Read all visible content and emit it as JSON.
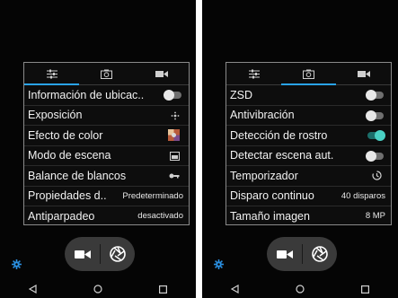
{
  "screens": [
    {
      "tabs": [
        {
          "icon": "sliders-icon"
        },
        {
          "icon": "camera-icon"
        },
        {
          "icon": "video-icon"
        }
      ],
      "active_tab": 0,
      "settings": [
        {
          "label": "Información de ubicac..",
          "control": "toggle",
          "state": "off"
        },
        {
          "label": "Exposición",
          "control": "icon",
          "icon": "exposure-icon"
        },
        {
          "label": "Efecto de color",
          "control": "icon",
          "icon": "color-effect-icon"
        },
        {
          "label": "Modo de escena",
          "control": "icon",
          "icon": "scene-mode-icon"
        },
        {
          "label": "Balance de blancos",
          "control": "icon",
          "icon": "white-balance-icon"
        },
        {
          "label": "Propiedades d..",
          "control": "value",
          "value": "Predeterminado"
        },
        {
          "label": "Antiparpadeo",
          "control": "value",
          "value": "desactivado"
        }
      ]
    },
    {
      "tabs": [
        {
          "icon": "sliders-icon"
        },
        {
          "icon": "camera-icon"
        },
        {
          "icon": "video-icon"
        }
      ],
      "active_tab": 1,
      "settings": [
        {
          "label": "ZSD",
          "control": "toggle",
          "state": "off"
        },
        {
          "label": "Antivibración",
          "control": "toggle",
          "state": "off"
        },
        {
          "label": "Detección de rostro",
          "control": "toggle",
          "state": "on"
        },
        {
          "label": "Detectar escena aut.",
          "control": "toggle",
          "state": "off"
        },
        {
          "label": "Temporizador",
          "control": "icon",
          "icon": "timer-icon"
        },
        {
          "label": "Disparo continuo",
          "control": "value",
          "value": "40 disparos"
        },
        {
          "label": "Tamaño imagen",
          "control": "value",
          "value": "8 MP"
        }
      ]
    }
  ],
  "controls": {
    "video_button": "video-mode-icon",
    "shutter_button": "shutter-icon",
    "settings_button": "gear-icon"
  },
  "navbar": [
    "back-icon",
    "home-icon",
    "recents-icon"
  ],
  "colors": {
    "accent": "#2aa3ea",
    "toggle_on": "#4ad0c4",
    "gear": "#2a8fe0"
  }
}
